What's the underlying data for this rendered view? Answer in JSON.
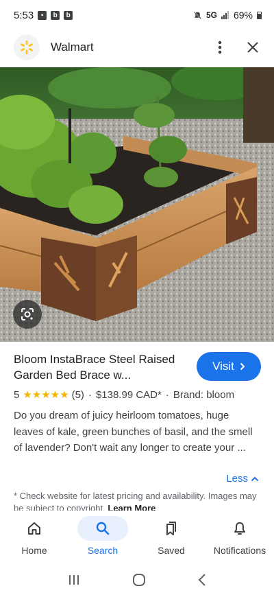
{
  "status_bar": {
    "time": "5:53",
    "notification_icons": [
      "image-icon",
      "b",
      "b"
    ],
    "network": "5G",
    "battery": "69%"
  },
  "header": {
    "site_name": "Walmart",
    "logo_icon": "walmart-spark-icon",
    "menu_icon": "more-vert-icon",
    "close_icon": "close-icon"
  },
  "image": {
    "lens_icon": "google-lens-icon"
  },
  "product": {
    "title": "Bloom InstaBrace Steel Raised Garden Bed Brace w...",
    "visit_label": "Visit",
    "rating_value": "5",
    "stars": "★★★★★",
    "review_count": "(5)",
    "price": "$138.99 CAD*",
    "brand": "Brand: bloom",
    "description": "Do you dream of juicy heirloom tomatoes, huge leaves of kale, green bunches of basil, and the smell of lavender? Don't wait any longer to create your ...",
    "less_label": "Less",
    "disclaimer": "* Check website for latest pricing and availability. Images may be subject to copyright.",
    "learn_more": "Learn More"
  },
  "bottom_nav": [
    {
      "label": "Home",
      "icon": "home-icon",
      "active": false
    },
    {
      "label": "Search",
      "icon": "search-icon",
      "active": true
    },
    {
      "label": "Saved",
      "icon": "bookmarks-icon",
      "active": false
    },
    {
      "label": "Notifications",
      "icon": "bell-icon",
      "active": false
    }
  ],
  "colors": {
    "accent": "#1a73e8",
    "star": "#f4b400",
    "walmart_spark": "#ffc220"
  }
}
